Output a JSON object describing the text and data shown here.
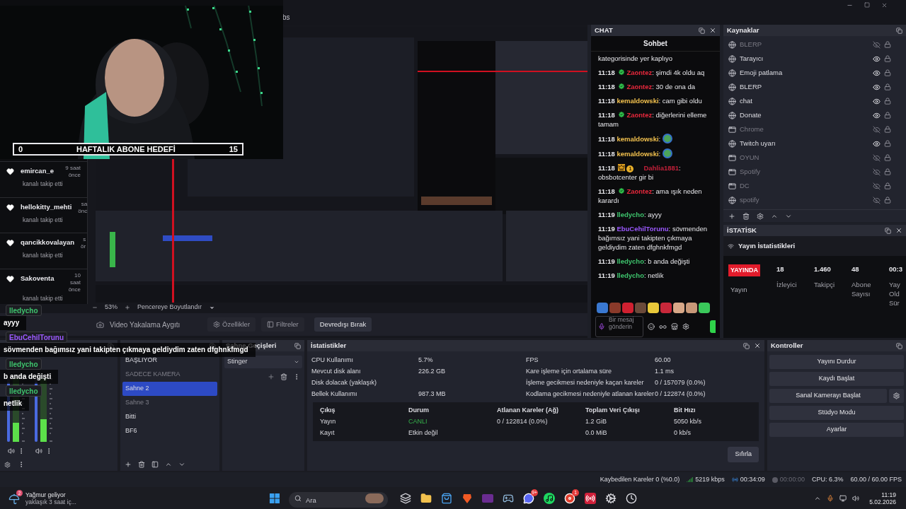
{
  "menu_fragment": "bs",
  "goal": {
    "current": "0",
    "title": "HAFTALIK ABONE HEDEFİ",
    "target": "15"
  },
  "alerts": [
    {
      "name": "emircan_e",
      "time": "9 saat önce",
      "action": "kanalı takip etti"
    },
    {
      "name": "hellokitty_mehti",
      "time": "sa önc",
      "action": "kanalı takip etti"
    },
    {
      "name": "qancikkovalayan",
      "time": "s ör",
      "action": "kanalı takip etti"
    },
    {
      "name": "Sakoventa",
      "time": "10 saat önce",
      "action": "kanalı takip etti"
    }
  ],
  "overlay_chat": [
    {
      "user": "lledycho",
      "color": "#3ec46d",
      "text": "ayyy"
    },
    {
      "user": "EbuCehilTorunu",
      "color": "#9b59ff",
      "text": "sövmenden bağımsız yani takipten çıkmaya geldiydim zaten dfghnkfmgd"
    },
    {
      "user": "lledycho",
      "color": "#3ec46d",
      "text": "b anda değişti"
    },
    {
      "user": "lledycho",
      "color": "#3ec46d",
      "text": "netlik"
    }
  ],
  "preview_toolbar": {
    "zoom": "53%",
    "fit": "Pencereye Boyutlandır"
  },
  "source_bar": {
    "source": "Video Yakalama Aygıtı",
    "buttons": [
      {
        "label": "Özellikler",
        "kind": "properties"
      },
      {
        "label": "Filtreler",
        "kind": "filters"
      },
      {
        "label": "Devredışı Bırak",
        "kind": "plain"
      }
    ]
  },
  "chat_dock": {
    "title": "CHAT",
    "heading": "Sohbet",
    "placeholder": "Bir mesaj gönderin",
    "messages": [
      {
        "kind": "continuation",
        "text": "kategorisinde yer kaplıyo"
      },
      {
        "kind": "text",
        "time": "11:18",
        "badges": [
          {
            "kind": "verified"
          }
        ],
        "user": "Zaontez",
        "color": "#e8283c",
        "text": ": şimdi 4k oldu aq"
      },
      {
        "kind": "text",
        "time": "11:18",
        "badges": [
          {
            "kind": "verified"
          }
        ],
        "user": "Zaontez",
        "color": "#e8283c",
        "text": ": 30 de ona da"
      },
      {
        "kind": "text",
        "time": "11:18",
        "user": "kemaldowski",
        "color": "#f2c14e",
        "text": ": cam gibi oldu"
      },
      {
        "kind": "text",
        "time": "11:18",
        "badges": [
          {
            "kind": "verified"
          }
        ],
        "user": "Zaontez",
        "color": "#e8283c",
        "text": ": diğerlerini elleme tamam"
      },
      {
        "kind": "emote",
        "time": "11:18",
        "user": "kemaldowski",
        "color": "#f2c14e",
        "text": ":"
      },
      {
        "kind": "emote",
        "time": "11:18",
        "user": "kemaldowski",
        "color": "#f2c14e",
        "text": ":"
      },
      {
        "kind": "text",
        "time": "11:18",
        "badges": [
          {
            "kind": "crown"
          },
          {
            "kind": "tier",
            "label": "1"
          }
        ],
        "user": "Dahlia1881",
        "color": "#c4203a",
        "text": ": obsbotcenter gir bi"
      },
      {
        "kind": "text",
        "time": "11:18",
        "badges": [
          {
            "kind": "verified"
          }
        ],
        "user": "Zaontez",
        "color": "#e8283c",
        "text": ": ama ışık neden karardı"
      },
      {
        "kind": "text",
        "time": "11:19",
        "user": "lledycho",
        "color": "#3ec46d",
        "text": ": ayyy"
      },
      {
        "kind": "text",
        "time": "11:19",
        "user": "EbuCehilTorunu",
        "color": "#9b59ff",
        "text": ": sövmenden bağımsız yani takipten çıkmaya geldiydim zaten dfghnkfmgd"
      },
      {
        "kind": "text",
        "time": "11:19",
        "user": "lledycho",
        "color": "#3ec46d",
        "text": ": b anda değişti"
      },
      {
        "kind": "text",
        "time": "11:19",
        "user": "lledycho",
        "color": "#3ec46d",
        "text": ": netlik"
      }
    ]
  },
  "sources": {
    "title": "Kaynaklar",
    "items": [
      {
        "name": "BLERP",
        "kind": "browser",
        "visible": false
      },
      {
        "name": "Tarayıcı",
        "kind": "browser",
        "visible": true
      },
      {
        "name": "Emoji patlama",
        "kind": "browser",
        "visible": true
      },
      {
        "name": "BLERP",
        "kind": "browser",
        "visible": true
      },
      {
        "name": "chat",
        "kind": "browser",
        "visible": true
      },
      {
        "name": "Donate",
        "kind": "browser",
        "visible": true
      },
      {
        "name": "Chrome",
        "kind": "window",
        "visible": false
      },
      {
        "name": "Twitch uyarı",
        "kind": "browser",
        "visible": true
      },
      {
        "name": "OYUN",
        "kind": "window",
        "visible": false
      },
      {
        "name": "Spotify",
        "kind": "window",
        "visible": false
      },
      {
        "name": "DC",
        "kind": "window",
        "visible": false
      },
      {
        "name": "spotify",
        "kind": "browser",
        "visible": false
      }
    ]
  },
  "stream_stats": {
    "title": "İSTATİSK",
    "heading": "Yayın İstatistikleri",
    "live_badge": "YAYINDA",
    "live_label": "Yayın",
    "metrics": [
      {
        "value": "18",
        "label": "İzleyici"
      },
      {
        "value": "1.460",
        "label": "Takipçi"
      },
      {
        "value": "48",
        "label": "Abone Sayısı"
      },
      {
        "value": "00:3",
        "label": "Yay Old Sür"
      }
    ]
  },
  "mixer": {
    "channels": [
      {
        "fader": {
          "level": 0.93
        },
        "meter": {
          "level": 0.3
        }
      },
      {
        "fader": {
          "level": 0.93
        },
        "meter": {
          "level": 0.36
        }
      }
    ]
  },
  "scenes": {
    "items": [
      {
        "name": "BAŞLIYOR",
        "selected": false,
        "dimmed": false
      },
      {
        "name": "SADECE KAMERA",
        "selected": false,
        "dimmed": true
      },
      {
        "name": "Sahne 2",
        "selected": true,
        "dimmed": false
      },
      {
        "name": "Sahne 3",
        "selected": false,
        "dimmed": true
      },
      {
        "name": "Bitti",
        "selected": false,
        "dimmed": false
      },
      {
        "name": "BF6",
        "selected": false,
        "dimmed": false
      }
    ]
  },
  "transitions": {
    "title": "Sahne Geçişleri",
    "value": "Stinger"
  },
  "stats": {
    "title": "İstatistikler",
    "left": [
      {
        "label": "CPU Kullanımı",
        "value": "5.7%"
      },
      {
        "label": "Mevcut disk alanı",
        "value": "226.2 GB"
      },
      {
        "label": "Disk dolacak (yaklaşık)"
      },
      {
        "label": "Bellek Kullanımı",
        "value": "987.3 MB"
      }
    ],
    "right": [
      {
        "label": "FPS",
        "value": "60.00"
      },
      {
        "label": "Kare işleme için ortalama süre",
        "value": "1.1 ms"
      },
      {
        "label": "İşleme gecikmesi nedeniyle kaçan kareler",
        "value": "0 / 157079 (0.0%)"
      },
      {
        "label": "Kodlama gecikmesi nedeniyle atlanan kareler",
        "value": "0 / 122874 (0.0%)"
      }
    ],
    "columns": [
      "Çıkış",
      "Durum",
      "Atlanan Kareler (Ağ)",
      "Toplam Veri Çıkışı",
      "Bit Hızı"
    ],
    "rows": [
      {
        "name": "Yayın",
        "status": "CANLI",
        "live": true,
        "skipped": "0 / 122814 (0.0%)",
        "total": "1.2 GiB",
        "bitrate": "5050 kb/s"
      },
      {
        "name": "Kayıt",
        "status": "Etkin değil",
        "live": false,
        "total": "0.0 MiB",
        "bitrate": "0 kb/s"
      }
    ],
    "reset": "Sıfırla"
  },
  "controls": {
    "title": "Kontroller",
    "buttons": [
      {
        "label": "Yayını Durdur",
        "kind": "plain"
      },
      {
        "label": "Kaydı Başlat",
        "kind": "plain"
      },
      {
        "label": "Sanal Kamerayı Başlat",
        "kind": "with-settings"
      },
      {
        "label": "Stüdyo Modu",
        "kind": "plain"
      },
      {
        "label": "Ayarlar",
        "kind": "plain"
      }
    ]
  },
  "status_bar": {
    "dropped": "Kaybedilen Kareler 0 (%0.0)",
    "bitrate": "5219 kbps",
    "stream_time": "00:34:09",
    "record_time": "00:00:00",
    "cpu": "CPU: 6.3%",
    "fps": "60.00 / 60.00 FPS"
  },
  "taskbar": {
    "weather": {
      "badge": "2",
      "title": "Yağmur geliyor",
      "subtitle": "yaklaşık 3 saat iç..."
    },
    "search": {
      "placeholder": "Ara"
    },
    "apps": [
      {
        "kind": "taskview"
      },
      {
        "kind": "folder"
      },
      {
        "kind": "store"
      },
      {
        "kind": "lion"
      },
      {
        "kind": "purple"
      },
      {
        "kind": "steam"
      },
      {
        "kind": "discord",
        "badge": "9+"
      },
      {
        "kind": "spotify"
      },
      {
        "kind": "red",
        "badge": "1"
      },
      {
        "kind": "record"
      },
      {
        "kind": "gear"
      },
      {
        "kind": "clock"
      }
    ],
    "time": "11:19",
    "date": "5.02.2026"
  }
}
